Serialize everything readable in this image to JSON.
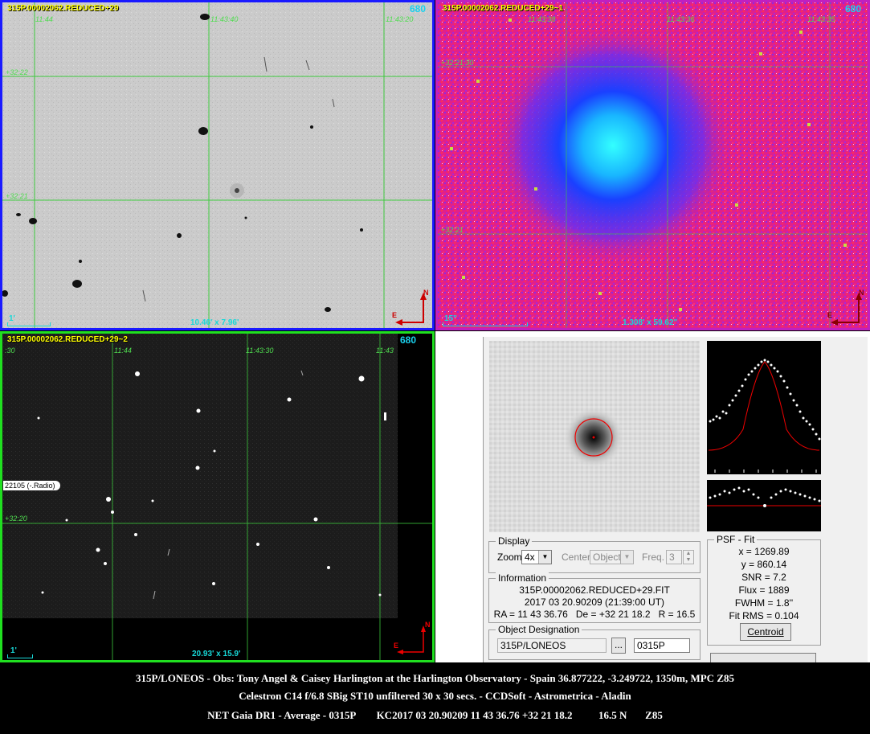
{
  "panels": {
    "tl": {
      "title": "315P.00002062.REDUCED+29",
      "id": "680",
      "grid_labels": [
        "11:44",
        "11:43:40",
        "11:43:20",
        "+32:22",
        "+32:21"
      ],
      "scale": "1'",
      "dims": "10.46' x 7.96'"
    },
    "tr": {
      "title": "315P.00002062.REDUCED+29~1",
      "id": "680",
      "grid_labels": [
        "11:43:38",
        "11:43:36",
        "11:43:35",
        "+32:21:30",
        "+32:21"
      ],
      "scale": "15\"",
      "dims": "1.308' x 59.62\""
    },
    "bl": {
      "title": "315P.00002062.REDUCED+29~2",
      "id": "680",
      "grid_labels": [
        ":30",
        "11:44",
        "11:43:30",
        "11:43",
        "+32:20"
      ],
      "object_tag": "22105 (-.Radio)",
      "scale": "1'",
      "dims": "20.93' x 15.9'"
    }
  },
  "compass": {
    "east": "E",
    "north": "N"
  },
  "psf": {
    "display": {
      "group_label": "Display",
      "zoom_label": "Zoom",
      "zoom_value": "4x",
      "center_label": "Center",
      "center_value": "Object",
      "freq_label": "Freq.",
      "freq_value": "3"
    },
    "info": {
      "group_label": "Information",
      "filename": "315P.00002062.REDUCED+29.FIT",
      "datetime": "2017 03 20.90209 (21:39:00 UT)",
      "coords": "RA = 11 43 36.76   De = +32 21 18.2   R = 16.5"
    },
    "designation": {
      "group_label": "Object Designation",
      "name_value": "315P/LONEOS",
      "browse_label": "...",
      "code_value": "0315P"
    },
    "fit": {
      "group_label": "PSF - Fit",
      "x": "x = 1269.89",
      "y": "y = 860.14",
      "snr": "SNR = 7.2",
      "flux": "Flux = 1889",
      "fwhm": "FWHM = 1.8''",
      "rms": "Fit RMS = 0.104",
      "centroid_label": "Centroid"
    }
  },
  "footer": {
    "line1": "315P/LONEOS - Obs: Tony Angel & Caisey Harlington at the Harlington Observatory - Spain 36.877222, -3.249722, 1350m, MPC Z85",
    "line2": "Celestron C14 f/6.8 SBig ST10 unfiltered 30 x 30 secs. - CCDSoft - Astrometrica - Aladin",
    "line3": "NET Gaia DR1 - Average - 0315P        KC2017 03 20.90209 11 43 36.76 +32 21 18.2          16.5 N       Z85"
  },
  "colors": {
    "tl_border": "#1a1aff",
    "tr_border": "#c020c0",
    "bl_border": "#20e020",
    "grid": "#3cc83c",
    "accent_cyan": "#18d8d8",
    "title_yellow": "#ffff00"
  }
}
